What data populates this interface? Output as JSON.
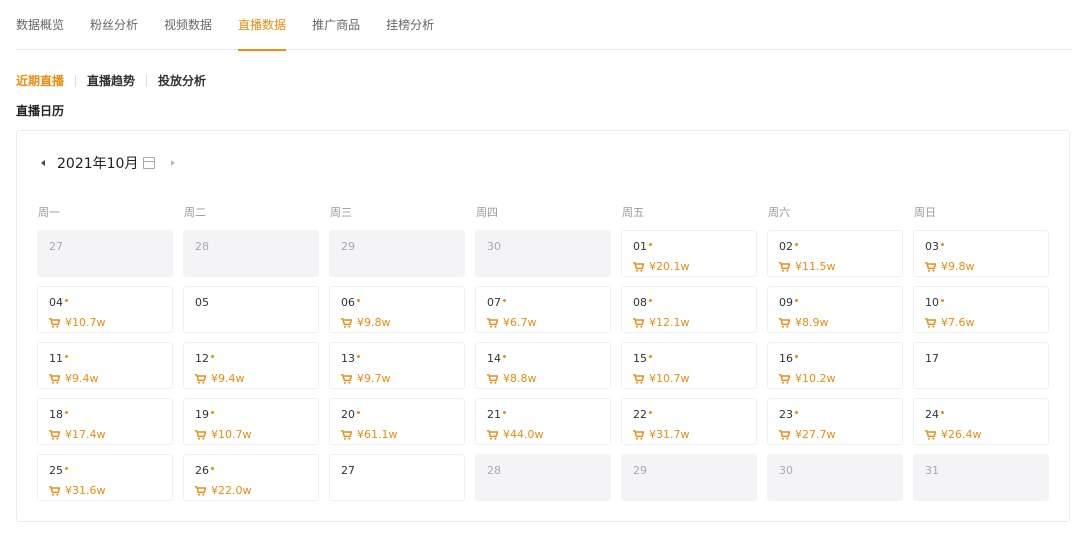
{
  "top_tabs": [
    {
      "label": "数据概览",
      "active": false
    },
    {
      "label": "粉丝分析",
      "active": false
    },
    {
      "label": "视频数据",
      "active": false
    },
    {
      "label": "直播数据",
      "active": true
    },
    {
      "label": "推广商品",
      "active": false
    },
    {
      "label": "挂榜分析",
      "active": false
    }
  ],
  "sub_tabs": [
    {
      "label": "近期直播",
      "active": true
    },
    {
      "label": "直播趋势",
      "active": false
    },
    {
      "label": "投放分析",
      "active": false
    }
  ],
  "section_title": "直播日历",
  "calendar": {
    "month_label": "2021年10月",
    "weekdays": [
      "周一",
      "周二",
      "周三",
      "周四",
      "周五",
      "周六",
      "周日"
    ],
    "weeks": [
      [
        {
          "day": "27",
          "in_month": false,
          "has_live": false,
          "amount": ""
        },
        {
          "day": "28",
          "in_month": false,
          "has_live": false,
          "amount": ""
        },
        {
          "day": "29",
          "in_month": false,
          "has_live": false,
          "amount": ""
        },
        {
          "day": "30",
          "in_month": false,
          "has_live": false,
          "amount": ""
        },
        {
          "day": "01",
          "in_month": true,
          "has_live": true,
          "amount": "¥20.1w"
        },
        {
          "day": "02",
          "in_month": true,
          "has_live": true,
          "amount": "¥11.5w"
        },
        {
          "day": "03",
          "in_month": true,
          "has_live": true,
          "amount": "¥9.8w"
        }
      ],
      [
        {
          "day": "04",
          "in_month": true,
          "has_live": true,
          "amount": "¥10.7w"
        },
        {
          "day": "05",
          "in_month": true,
          "has_live": false,
          "amount": ""
        },
        {
          "day": "06",
          "in_month": true,
          "has_live": true,
          "amount": "¥9.8w"
        },
        {
          "day": "07",
          "in_month": true,
          "has_live": true,
          "amount": "¥6.7w"
        },
        {
          "day": "08",
          "in_month": true,
          "has_live": true,
          "amount": "¥12.1w"
        },
        {
          "day": "09",
          "in_month": true,
          "has_live": true,
          "amount": "¥8.9w"
        },
        {
          "day": "10",
          "in_month": true,
          "has_live": true,
          "amount": "¥7.6w"
        }
      ],
      [
        {
          "day": "11",
          "in_month": true,
          "has_live": true,
          "amount": "¥9.4w"
        },
        {
          "day": "12",
          "in_month": true,
          "has_live": true,
          "amount": "¥9.4w"
        },
        {
          "day": "13",
          "in_month": true,
          "has_live": true,
          "amount": "¥9.7w"
        },
        {
          "day": "14",
          "in_month": true,
          "has_live": true,
          "amount": "¥8.8w"
        },
        {
          "day": "15",
          "in_month": true,
          "has_live": true,
          "amount": "¥10.7w"
        },
        {
          "day": "16",
          "in_month": true,
          "has_live": true,
          "amount": "¥10.2w"
        },
        {
          "day": "17",
          "in_month": true,
          "has_live": false,
          "amount": ""
        }
      ],
      [
        {
          "day": "18",
          "in_month": true,
          "has_live": true,
          "amount": "¥17.4w"
        },
        {
          "day": "19",
          "in_month": true,
          "has_live": true,
          "amount": "¥10.7w"
        },
        {
          "day": "20",
          "in_month": true,
          "has_live": true,
          "amount": "¥61.1w"
        },
        {
          "day": "21",
          "in_month": true,
          "has_live": true,
          "amount": "¥44.0w"
        },
        {
          "day": "22",
          "in_month": true,
          "has_live": true,
          "amount": "¥31.7w"
        },
        {
          "day": "23",
          "in_month": true,
          "has_live": true,
          "amount": "¥27.7w"
        },
        {
          "day": "24",
          "in_month": true,
          "has_live": true,
          "amount": "¥26.4w"
        }
      ],
      [
        {
          "day": "25",
          "in_month": true,
          "has_live": true,
          "amount": "¥31.6w"
        },
        {
          "day": "26",
          "in_month": true,
          "has_live": true,
          "amount": "¥22.0w"
        },
        {
          "day": "27",
          "in_month": true,
          "has_live": false,
          "amount": ""
        },
        {
          "day": "28",
          "in_month": false,
          "has_live": false,
          "amount": ""
        },
        {
          "day": "29",
          "in_month": false,
          "has_live": false,
          "amount": ""
        },
        {
          "day": "30",
          "in_month": false,
          "has_live": false,
          "amount": ""
        },
        {
          "day": "31",
          "in_month": false,
          "has_live": false,
          "amount": ""
        }
      ]
    ]
  },
  "colors": {
    "accent": "#f08c12",
    "other_month_bg": "#f4f4f6"
  },
  "icons": {
    "prev": "caret-left-icon",
    "next": "caret-right-icon",
    "date_picker": "calendar-icon",
    "amount": "shopping-cart-icon"
  }
}
